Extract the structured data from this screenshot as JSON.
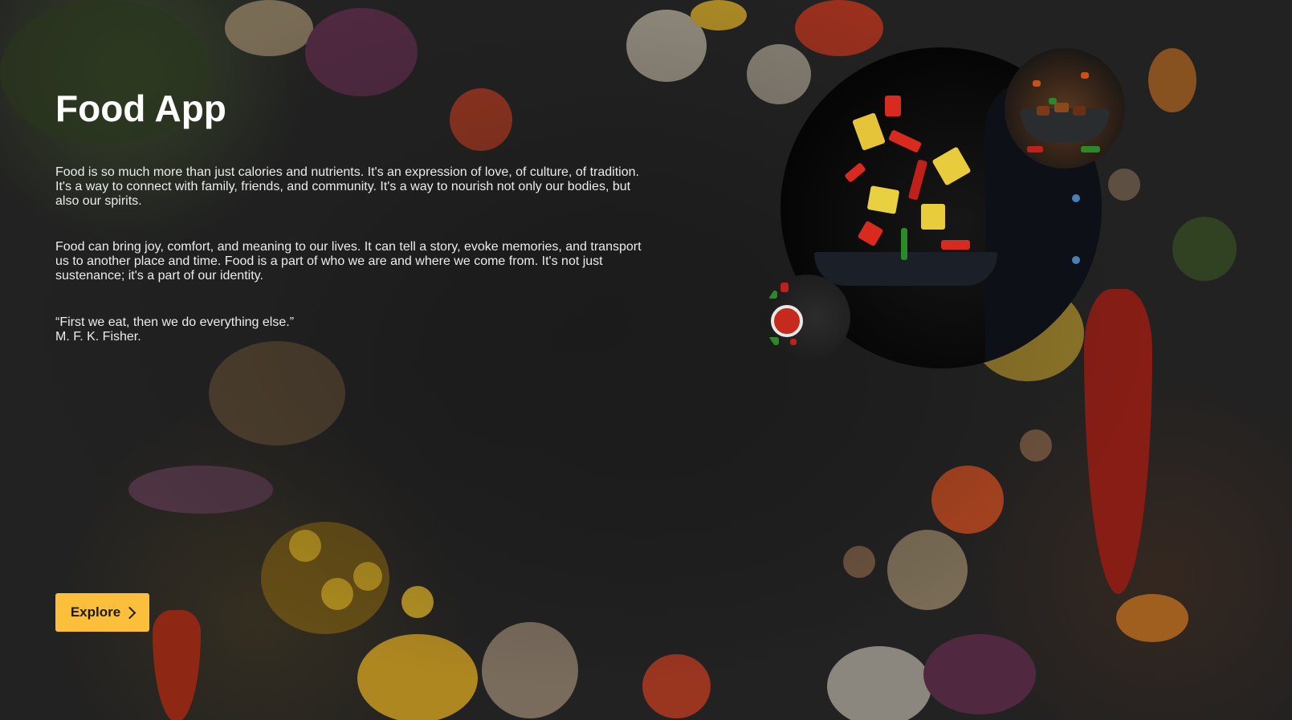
{
  "app": {
    "title": "Food App"
  },
  "main": {
    "paragraph1": "Food is so much more than just calories and nutrients. It's an expression of love, of culture, of tradition. It's a way to connect with family, friends, and community. It's a way to nourish not only our bodies, but also our spirits.",
    "paragraph2": "Food can bring joy, comfort, and meaning to our lives. It can tell a story, evoke memories, and transport us to another place and time. Food is a part of who we are and where we come from. It's not just sustenance; it's a part of our identity.",
    "quote": "“First we eat, then we do everything else.”",
    "quote_author": "M. F. K. Fisher."
  },
  "cta": {
    "label": "Explore",
    "icon": "chevron-right-icon",
    "color": "#fbbf3c"
  },
  "images": {
    "main": "chef-tossing-vegetables-in-wok",
    "top_right": "stir-fry-bowl",
    "small": "sauce-bowl-with-vegetables"
  }
}
